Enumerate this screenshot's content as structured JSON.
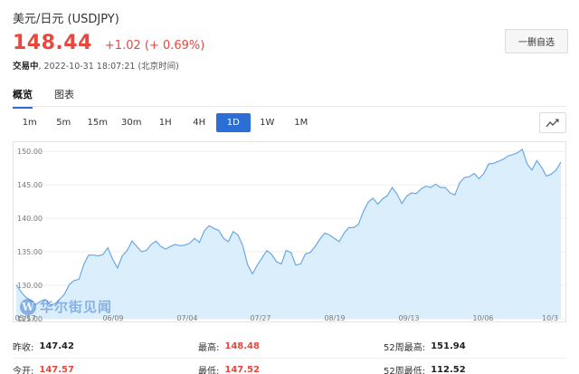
{
  "header": {
    "title": "美元/日元 (USDJPY)",
    "price": "148.44",
    "change": "+1.02 (+ 0.69%)",
    "status": "交易中",
    "timestamp": ", 2022-10-31 18:07:21 (北京时间)",
    "watch_button": "一删自选"
  },
  "tabs": [
    "概览",
    "图表"
  ],
  "periods": [
    "1m",
    "5m",
    "15m",
    "30m",
    "1H",
    "4H",
    "1D",
    "1W",
    "1M"
  ],
  "active_period": "1D",
  "watermark": {
    "logo": "W",
    "text": "华尔街见闻"
  },
  "colors": {
    "up": "#e9473e",
    "accent": "#2b6fd6",
    "area_fill": "#dbeefc",
    "line": "#6aa8e6"
  },
  "stats": {
    "prev_close": {
      "label": "昨收:",
      "value": "147.42"
    },
    "high": {
      "label": "最高:",
      "value": "148.48"
    },
    "week52_high": {
      "label": "52周最高:",
      "value": "151.94"
    },
    "open": {
      "label": "今开:",
      "value": "147.57"
    },
    "low": {
      "label": "最低:",
      "value": "147.52"
    },
    "week52_low": {
      "label": "52周最低:",
      "value": "112.52"
    }
  },
  "chart_data": {
    "type": "area",
    "ylim": [
      125,
      151.5
    ],
    "y_ticks": [
      125,
      130,
      135,
      140,
      145,
      150
    ],
    "y_tick_labels": [
      "125.00",
      "130.00",
      "135.00",
      "140.00",
      "145.00",
      "150.00"
    ],
    "x_tick_labels": [
      "05/17",
      "06/09",
      "07/04",
      "07/27",
      "08/19",
      "09/13",
      "10/06",
      "10/3"
    ],
    "values": [
      130.1,
      129.0,
      128.2,
      127.7,
      127.1,
      127.6,
      127.9,
      127.1,
      127.2,
      127.9,
      128.7,
      130.1,
      130.7,
      130.9,
      133.1,
      134.5,
      134.5,
      134.4,
      134.6,
      135.6,
      133.9,
      132.6,
      134.4,
      135.2,
      136.6,
      135.8,
      135.0,
      135.2,
      136.1,
      136.6,
      135.8,
      135.4,
      135.8,
      136.1,
      135.9,
      136.0,
      136.3,
      137.0,
      136.4,
      138.1,
      138.9,
      138.5,
      138.2,
      137.0,
      136.5,
      138.0,
      137.5,
      135.9,
      133.1,
      131.7,
      133.0,
      134.1,
      135.2,
      134.6,
      133.5,
      133.2,
      135.2,
      134.9,
      133.0,
      133.2,
      134.7,
      134.9,
      135.8,
      136.9,
      137.8,
      137.5,
      137.0,
      136.5,
      137.8,
      138.6,
      138.6,
      139.1,
      141.0,
      142.4,
      143.0,
      142.1,
      142.9,
      143.4,
      144.6,
      143.6,
      142.2,
      143.3,
      143.8,
      143.7,
      144.4,
      144.8,
      144.6,
      145.1,
      144.6,
      144.6,
      143.8,
      143.5,
      145.3,
      146.1,
      146.2,
      146.7,
      145.9,
      146.7,
      148.1,
      148.2,
      148.5,
      148.8,
      149.3,
      149.5,
      149.8,
      150.3,
      148.1,
      147.2,
      148.6,
      147.6,
      146.3,
      146.6,
      147.2,
      148.4
    ]
  }
}
